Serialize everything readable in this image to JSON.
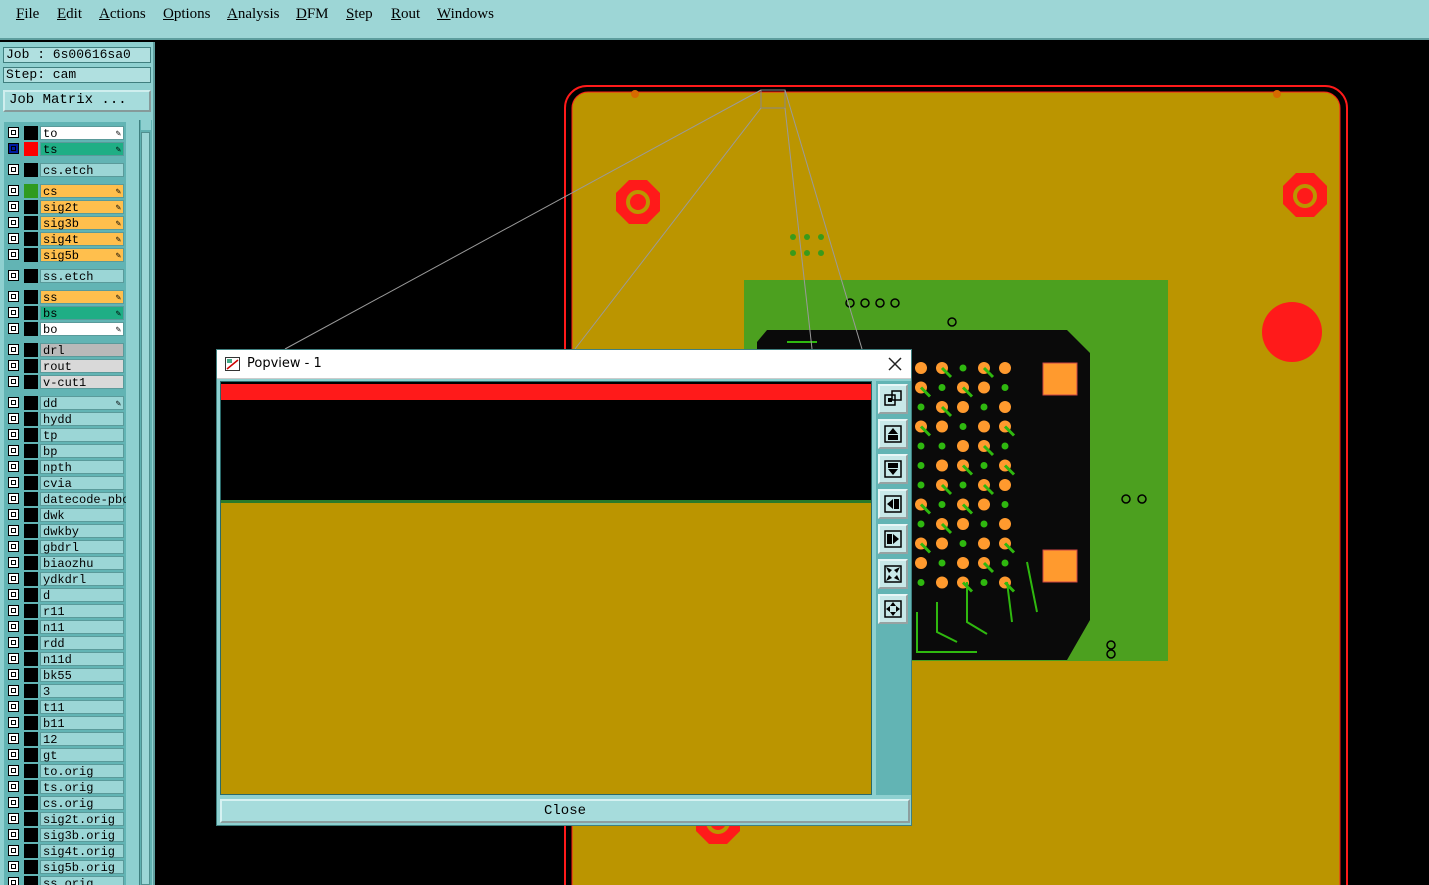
{
  "menu": [
    "File",
    "Edit",
    "Actions",
    "Options",
    "Analysis",
    "DFM",
    "Step",
    "Rout",
    "Windows"
  ],
  "job": {
    "job_text": "Job : 6s00616sa0",
    "step_text": "Step: cam",
    "matrix_label": "Job Matrix ..."
  },
  "layers": [
    {
      "name": "to",
      "color": "#ffffff",
      "swatch": "#000000",
      "edit": true
    },
    {
      "name": "ts",
      "color": "#1fae85",
      "swatch": "#ff0000",
      "edit": true,
      "selected": true
    },
    {
      "name": "cs.etch",
      "color": "#9bd6d6",
      "swatch": "#000000",
      "edit": false
    },
    {
      "name": "cs",
      "color": "#ffbf4d",
      "swatch": "#2f9b1f",
      "edit": true
    },
    {
      "name": "sig2t",
      "color": "#ffbf4d",
      "swatch": "#000000",
      "edit": true
    },
    {
      "name": "sig3b",
      "color": "#ffbf4d",
      "swatch": "#000000",
      "edit": true
    },
    {
      "name": "sig4t",
      "color": "#ffbf4d",
      "swatch": "#000000",
      "edit": true
    },
    {
      "name": "sig5b",
      "color": "#ffbf4d",
      "swatch": "#000000",
      "edit": true
    },
    {
      "name": "ss.etch",
      "color": "#9bd6d6",
      "swatch": "#000000",
      "edit": false
    },
    {
      "name": "ss",
      "color": "#ffbf4d",
      "swatch": "#000000",
      "edit": true
    },
    {
      "name": "bs",
      "color": "#1fae85",
      "swatch": "#000000",
      "edit": true
    },
    {
      "name": "bo",
      "color": "#ffffff",
      "swatch": "#000000",
      "edit": true
    },
    {
      "name": "drl",
      "color": "#b9b9b9",
      "swatch": "#000000",
      "edit": false
    },
    {
      "name": "rout",
      "color": "#d9d9d9",
      "swatch": "#000000",
      "edit": false
    },
    {
      "name": "v-cut1",
      "color": "#d9d9d9",
      "swatch": "#000000",
      "edit": false
    },
    {
      "name": "dd",
      "color": "#9bd6d6",
      "swatch": "#000000",
      "edit": true
    },
    {
      "name": "hydd",
      "color": "#9bd6d6",
      "swatch": "#000000",
      "edit": false
    },
    {
      "name": "tp",
      "color": "#9bd6d6",
      "swatch": "#000000",
      "edit": false
    },
    {
      "name": "bp",
      "color": "#9bd6d6",
      "swatch": "#000000",
      "edit": false
    },
    {
      "name": "npth",
      "color": "#9bd6d6",
      "swatch": "#000000",
      "edit": false
    },
    {
      "name": "cvia",
      "color": "#9bd6d6",
      "swatch": "#000000",
      "edit": false
    },
    {
      "name": "datecode-pbo",
      "color": "#9bd6d6",
      "swatch": "#000000",
      "edit": false
    },
    {
      "name": "dwk",
      "color": "#9bd6d6",
      "swatch": "#000000",
      "edit": false
    },
    {
      "name": "dwkby",
      "color": "#9bd6d6",
      "swatch": "#000000",
      "edit": false
    },
    {
      "name": "gbdrl",
      "color": "#9bd6d6",
      "swatch": "#000000",
      "edit": false
    },
    {
      "name": "biaozhu",
      "color": "#9bd6d6",
      "swatch": "#000000",
      "edit": false
    },
    {
      "name": "ydkdrl",
      "color": "#9bd6d6",
      "swatch": "#000000",
      "edit": false
    },
    {
      "name": "d",
      "color": "#9bd6d6",
      "swatch": "#000000",
      "edit": false
    },
    {
      "name": "r11",
      "color": "#9bd6d6",
      "swatch": "#000000",
      "edit": false
    },
    {
      "name": "n11",
      "color": "#9bd6d6",
      "swatch": "#000000",
      "edit": false
    },
    {
      "name": "rdd",
      "color": "#9bd6d6",
      "swatch": "#000000",
      "edit": false
    },
    {
      "name": "n11d",
      "color": "#9bd6d6",
      "swatch": "#000000",
      "edit": false
    },
    {
      "name": "bk55",
      "color": "#9bd6d6",
      "swatch": "#000000",
      "edit": false
    },
    {
      "name": "3",
      "color": "#9bd6d6",
      "swatch": "#000000",
      "edit": false
    },
    {
      "name": "t11",
      "color": "#9bd6d6",
      "swatch": "#000000",
      "edit": false
    },
    {
      "name": "b11",
      "color": "#9bd6d6",
      "swatch": "#000000",
      "edit": false
    },
    {
      "name": "12",
      "color": "#9bd6d6",
      "swatch": "#000000",
      "edit": false
    },
    {
      "name": "gt",
      "color": "#9bd6d6",
      "swatch": "#000000",
      "edit": false
    },
    {
      "name": "to.orig",
      "color": "#9bd6d6",
      "swatch": "#000000",
      "edit": false
    },
    {
      "name": "ts.orig",
      "color": "#9bd6d6",
      "swatch": "#000000",
      "edit": false
    },
    {
      "name": "cs.orig",
      "color": "#9bd6d6",
      "swatch": "#000000",
      "edit": false
    },
    {
      "name": "sig2t.orig",
      "color": "#9bd6d6",
      "swatch": "#000000",
      "edit": false
    },
    {
      "name": "sig3b.orig",
      "color": "#9bd6d6",
      "swatch": "#000000",
      "edit": false
    },
    {
      "name": "sig4t.orig",
      "color": "#9bd6d6",
      "swatch": "#000000",
      "edit": false
    },
    {
      "name": "sig5b.orig",
      "color": "#9bd6d6",
      "swatch": "#000000",
      "edit": false
    },
    {
      "name": "ss.orig",
      "color": "#9bd6d6",
      "swatch": "#000000",
      "edit": false
    }
  ],
  "popview": {
    "title": "Popview - 1",
    "close_label": "Close"
  },
  "colors": {
    "board_fill": "#bb9500",
    "outline": "#ff1a1a",
    "copper_green": "#4ca01f",
    "pad_orange": "#ff9a2e",
    "trace_green": "#2fb80f"
  }
}
